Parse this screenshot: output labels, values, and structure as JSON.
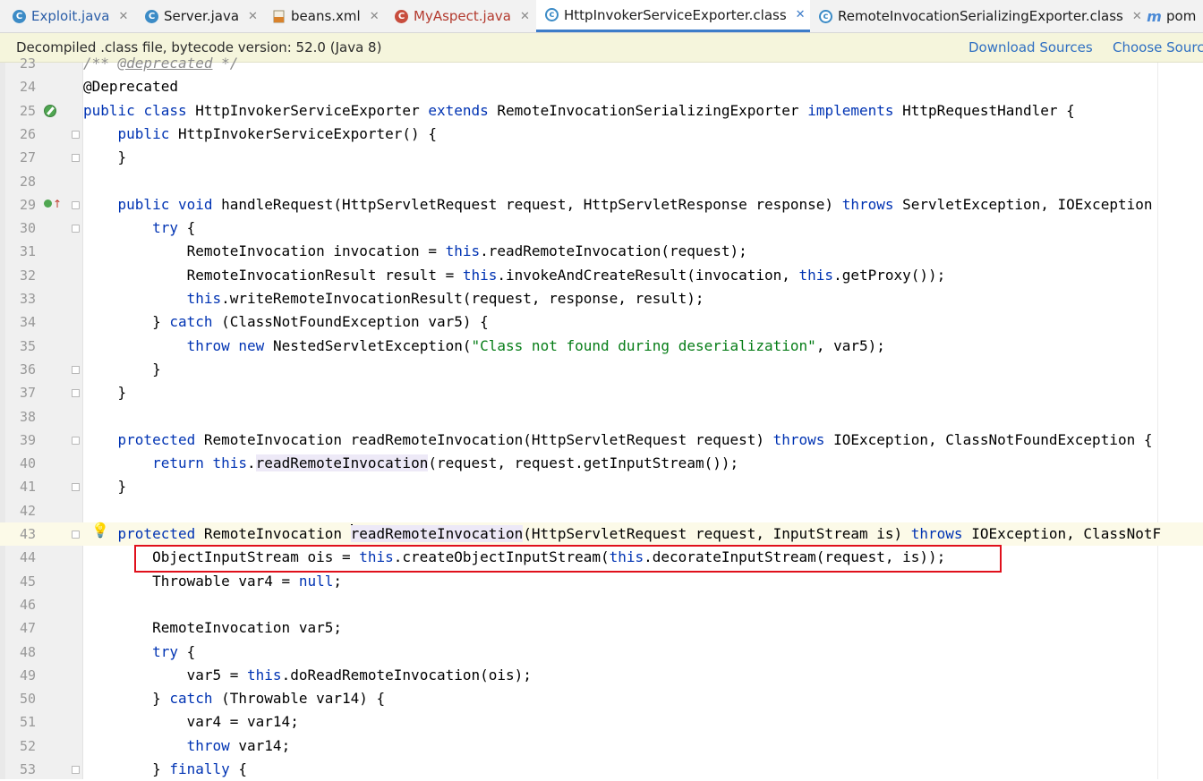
{
  "tabs": [
    {
      "label": "Exploit.java",
      "icon": "java-class-icon",
      "active": false
    },
    {
      "label": "Server.java",
      "icon": "java-class-icon",
      "active": false
    },
    {
      "label": "beans.xml",
      "icon": "xml-file-icon",
      "active": false
    },
    {
      "label": "MyAspect.java",
      "icon": "aspect-class-icon",
      "active": false
    },
    {
      "label": "HttpInvokerServiceExporter.class",
      "icon": "class-file-icon",
      "active": true
    },
    {
      "label": "RemoteInvocationSerializingExporter.class",
      "icon": "class-file-icon",
      "active": false
    },
    {
      "label": "pom",
      "icon": "maven-pom-icon",
      "active": false
    }
  ],
  "notice": {
    "message": "Decompiled .class file, bytecode version: 52.0 (Java 8)",
    "download_sources": "Download Sources",
    "choose_sources": "Choose Sources..."
  },
  "code": {
    "lines": [
      {
        "n": "23",
        "text": "/** @deprecated */"
      },
      {
        "n": "24",
        "text": "@Deprecated"
      },
      {
        "n": "25",
        "text": "public class HttpInvokerServiceExporter extends RemoteInvocationSerializingExporter implements HttpRequestHandler {"
      },
      {
        "n": "26",
        "text": "    public HttpInvokerServiceExporter() {"
      },
      {
        "n": "27",
        "text": "    }"
      },
      {
        "n": "28",
        "text": ""
      },
      {
        "n": "29",
        "text": "    public void handleRequest(HttpServletRequest request, HttpServletResponse response) throws ServletException, IOException"
      },
      {
        "n": "30",
        "text": "        try {"
      },
      {
        "n": "31",
        "text": "            RemoteInvocation invocation = this.readRemoteInvocation(request);"
      },
      {
        "n": "32",
        "text": "            RemoteInvocationResult result = this.invokeAndCreateResult(invocation, this.getProxy());"
      },
      {
        "n": "33",
        "text": "            this.writeRemoteInvocationResult(request, response, result);"
      },
      {
        "n": "34",
        "text": "        } catch (ClassNotFoundException var5) {"
      },
      {
        "n": "35",
        "text": "            throw new NestedServletException(\"Class not found during deserialization\", var5);"
      },
      {
        "n": "36",
        "text": "        }"
      },
      {
        "n": "37",
        "text": "    }"
      },
      {
        "n": "38",
        "text": ""
      },
      {
        "n": "39",
        "text": "    protected RemoteInvocation readRemoteInvocation(HttpServletRequest request) throws IOException, ClassNotFoundException {"
      },
      {
        "n": "40",
        "text": "        return this.readRemoteInvocation(request, request.getInputStream());"
      },
      {
        "n": "41",
        "text": "    }"
      },
      {
        "n": "42",
        "text": ""
      },
      {
        "n": "43",
        "text": "    protected RemoteInvocation readRemoteInvocation(HttpServletRequest request, InputStream is) throws IOException, ClassNotF"
      },
      {
        "n": "44",
        "text": "        ObjectInputStream ois = this.createObjectInputStream(this.decorateInputStream(request, is));"
      },
      {
        "n": "45",
        "text": "        Throwable var4 = null;"
      },
      {
        "n": "46",
        "text": ""
      },
      {
        "n": "47",
        "text": "        RemoteInvocation var5;"
      },
      {
        "n": "48",
        "text": "        try {"
      },
      {
        "n": "49",
        "text": "            var5 = this.doReadRemoteInvocation(ois);"
      },
      {
        "n": "50",
        "text": "        } catch (Throwable var14) {"
      },
      {
        "n": "51",
        "text": "            var4 = var14;"
      },
      {
        "n": "52",
        "text": "            throw var14;"
      },
      {
        "n": "53",
        "text": "        } finally {"
      }
    ],
    "current_line": "43",
    "highlighted_line": "44"
  },
  "colors": {
    "keyword": "#0033b3",
    "string": "#067d17",
    "comment": "#8c8c8c",
    "highlight_box": "#e0101b",
    "notice_bg": "#f5f5dc",
    "link": "#2f6fc2"
  }
}
